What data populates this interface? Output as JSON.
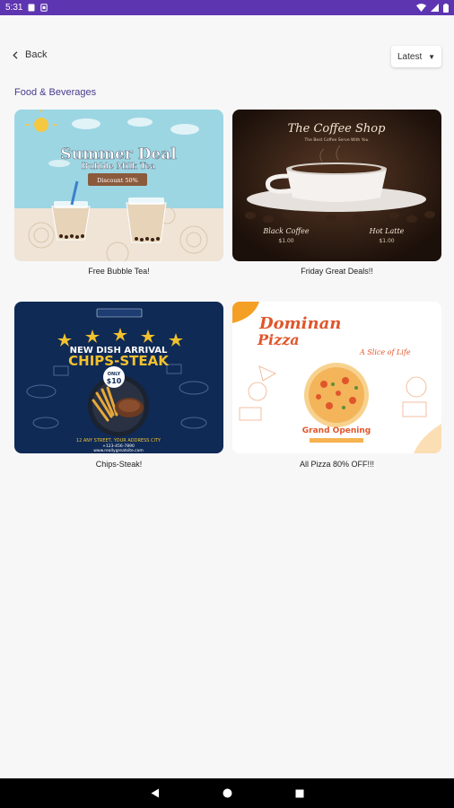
{
  "status_bar": {
    "time": "5:31"
  },
  "topbar": {
    "back_label": "Back",
    "sort_value": "Latest"
  },
  "section": {
    "title": "Food & Beverages"
  },
  "cards": [
    {
      "caption": "Free Bubble Tea!",
      "poster_title": "Summer Deal",
      "poster_subtitle": "Bubble Milk Tea",
      "poster_tag": "Discount 50%"
    },
    {
      "caption": "Friday Great Deals!!",
      "poster_title": "The Coffee Shop",
      "poster_tagline": "The Best Coffee Serve With You",
      "item1_name": "Black Coffee",
      "item1_price": "$1.00",
      "item2_name": "Hot Latte",
      "item2_price": "$1.00"
    },
    {
      "caption": "Chips-Steak!",
      "poster_header": "NEW DISH ARRIVAL",
      "poster_title": "CHIPS-STEAK",
      "poster_badge_top": "ONLY",
      "poster_badge_price": "$10",
      "poster_address": "12 ANY STREET, YOUR ADDRESS CITY",
      "poster_phone": "+123-456-7890",
      "poster_web": "www.reallygreatsite.com"
    },
    {
      "caption": "All Pizza 80% OFF!!!",
      "poster_title_1": "Dominan",
      "poster_title_2": "Pizza",
      "poster_tagline": "A Slice of Life",
      "poster_event": "Grand Opening"
    }
  ],
  "colors": {
    "status_bar": "#5e35b1",
    "section_title": "#4a3b8c",
    "coffee_bg": "#2b1a12",
    "steak_bg": "#0f2a55",
    "pizza_accent": "#f4a024"
  },
  "icons": {
    "back": "chevron-left-icon",
    "sort": "caret-down-icon",
    "nav_back": "triangle-back-icon",
    "nav_home": "circle-home-icon",
    "nav_recents": "square-recents-icon"
  }
}
